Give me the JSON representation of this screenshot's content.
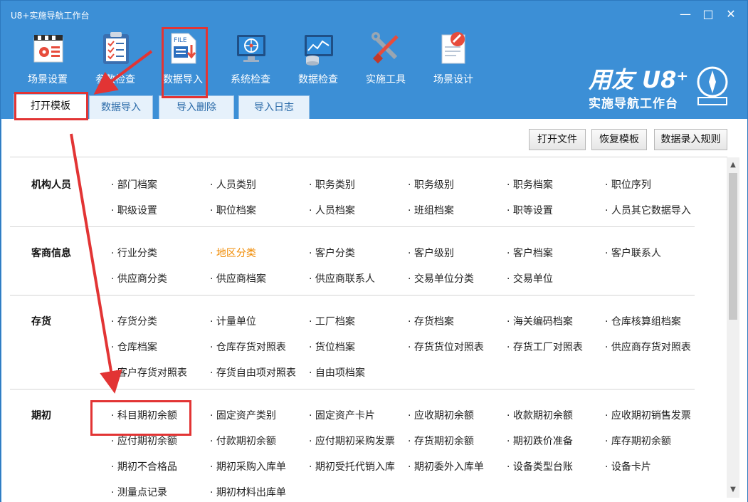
{
  "window": {
    "title": "U8+实施导航工作台",
    "minimize_icon": "minimize-icon",
    "maximize_icon": "maximize-icon",
    "close_icon": "close-icon"
  },
  "toolbar": {
    "items": [
      {
        "label": "场景设置",
        "icon": "scene-settings-icon"
      },
      {
        "label": "参数检查",
        "icon": "checklist-icon"
      },
      {
        "label": "数据导入",
        "icon": "file-import-icon"
      },
      {
        "label": "系统检查",
        "icon": "monitor-check-icon"
      },
      {
        "label": "数据检查",
        "icon": "database-chart-icon"
      },
      {
        "label": "实施工具",
        "icon": "tools-icon"
      },
      {
        "label": "场景设计",
        "icon": "scene-design-icon"
      }
    ]
  },
  "brand": {
    "line1": "用友 U8⁺",
    "line2": "实施导航工作台"
  },
  "subtabs": [
    "打开模板",
    "数据导入",
    "导入删除",
    "导入日志"
  ],
  "buttons": {
    "open_file": "打开文件",
    "restore_template": "恢复模板",
    "entry_rules": "数据录入规则"
  },
  "sections": [
    {
      "title": "机构人员",
      "items": [
        "部门档案",
        "人员类别",
        "职务类别",
        "职务级别",
        "职务档案",
        "职位序列",
        "职级设置",
        "职位档案",
        "人员档案",
        "班组档案",
        "职等设置",
        "人员其它数据导入"
      ]
    },
    {
      "title": "客商信息",
      "items": [
        "行业分类",
        "地区分类",
        "客户分类",
        "客户级别",
        "客户档案",
        "客户联系人",
        "供应商分类",
        "供应商档案",
        "供应商联系人",
        "交易单位分类",
        "交易单位"
      ]
    },
    {
      "title": "存货",
      "items": [
        "存货分类",
        "计量单位",
        "工厂档案",
        "存货档案",
        "海关编码档案",
        "仓库核算组档案",
        "仓库档案",
        "仓库存货对照表",
        "货位档案",
        "存货货位对照表",
        "存货工厂对照表",
        "供应商存货对照表",
        "客户存货对照表",
        "存货自由项对照表",
        "自由项档案"
      ]
    },
    {
      "title": "期初",
      "items": [
        "科目期初余额",
        "固定资产类别",
        "固定资产卡片",
        "应收期初余额",
        "收款期初余额",
        "应收期初销售发票",
        "应付期初余额",
        "付款期初余额",
        "应付期初采购发票",
        "存货期初余额",
        "期初跌价准备",
        "库存期初余额",
        "期初不合格品",
        "期初采购入库单",
        "期初受托代销入库",
        "期初委外入库单",
        "设备类型台账",
        "设备卡片",
        "测量点记录",
        "期初材料出库单"
      ]
    }
  ],
  "highlighted_item": "地区分类",
  "bullet": "·",
  "scroll": {
    "up_icon": "scroll-up-icon",
    "down_icon": "scroll-down-icon"
  },
  "colors": {
    "chrome_blue": "#3c8fd6",
    "highlight_orange": "#f08a00",
    "annotation_red": "#e23434"
  }
}
